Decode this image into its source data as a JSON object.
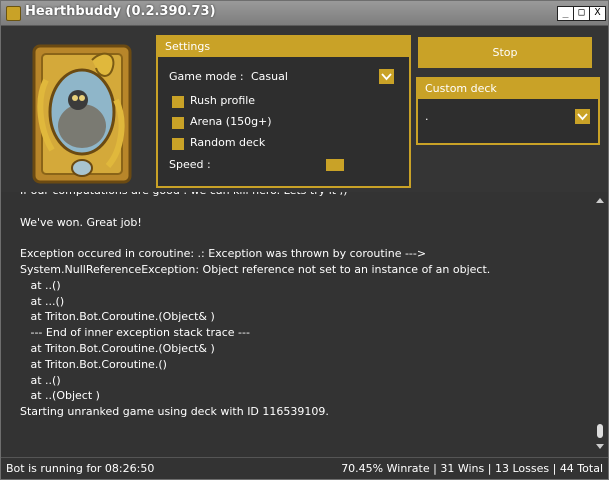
{
  "window": {
    "title": "Hearthbuddy (0.2.390.73)",
    "min_glyph": "_",
    "max_glyph": "□",
    "close_glyph": "X"
  },
  "colors": {
    "accent": "#c9a227",
    "background": "#333333",
    "text": "#ffffff"
  },
  "settings": {
    "header": "Settings",
    "game_mode_label": "Game mode :",
    "game_mode_value": "Casual",
    "options": [
      {
        "label": "Rush profile"
      },
      {
        "label": "Arena (150g+)"
      },
      {
        "label": "Random deck"
      }
    ],
    "speed_label": "Speed :"
  },
  "stop_button": {
    "label": "Stop"
  },
  "custom_deck": {
    "header": "Custom deck",
    "value": "."
  },
  "log": {
    "lines": [
      "If our computations are good : we can kill hero. Lets try it ;)",
      "",
      "We've won. Great job!",
      "",
      "Exception occured in coroutine: .: Exception was thrown by coroutine --->",
      "System.NullReferenceException: Object reference not set to an instance of an object.",
      "   at ..()",
      "   at ...()",
      "   at Triton.Bot.Coroutine.(Object& )",
      "   --- End of inner exception stack trace ---",
      "   at Triton.Bot.Coroutine.(Object& )",
      "   at Triton.Bot.Coroutine.()",
      "   at ..()",
      "   at ..(Object )",
      "Starting unranked game using deck with ID 116539109."
    ]
  },
  "status": {
    "running": "Bot is running for 08:26:50",
    "winrate": "70.45% Winrate",
    "wins": "31 Wins",
    "losses": "13 Losses",
    "total": "44 Total",
    "separator": "|"
  }
}
